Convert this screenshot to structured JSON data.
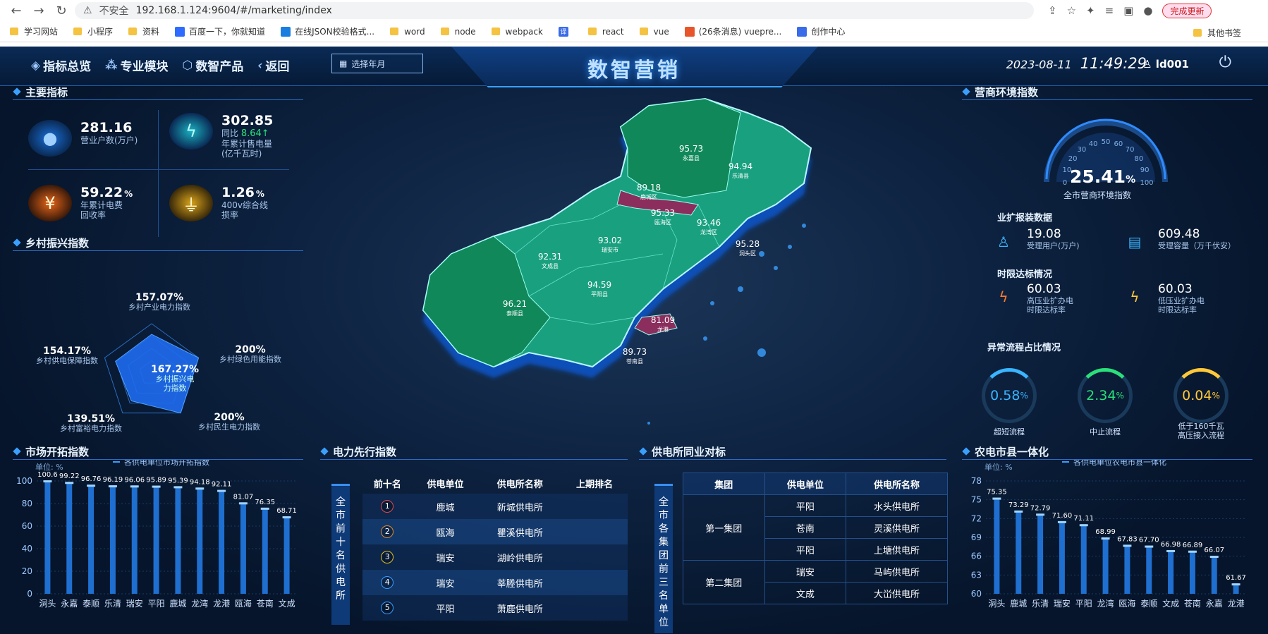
{
  "browser": {
    "insecure": "不安全",
    "url": "192.168.1.124:9604/#/marketing/index",
    "update": "完成更新",
    "bookmarks": [
      "学习网站",
      "小程序",
      "资料",
      "百度一下，你就知道",
      "在线JSON校验格式...",
      "word",
      "node",
      "webpack",
      "译",
      "react",
      "vue",
      "(26条消息) vuepre...",
      "创作中心"
    ],
    "bookmarks_right": "其他书签"
  },
  "header": {
    "title": "数智营销",
    "nav": [
      "指标总览",
      "专业模块",
      "数智产品",
      "返回"
    ],
    "month_placeholder": "选择年月",
    "date": "2023-08-11",
    "time": "11:49:29",
    "user": "ld001"
  },
  "main_index": {
    "title": "主要指标",
    "kpis": [
      {
        "value": "281.16",
        "label": "营业户数(万户)"
      },
      {
        "value": "302.85",
        "yoy_label": "同比",
        "yoy": "8.64↑",
        "label1": "年累计售电量",
        "label2": "(亿千瓦时)"
      },
      {
        "value": "59.22",
        "unit": "%",
        "label1": "年累计电费",
        "label2": "回收率"
      },
      {
        "value": "1.26",
        "unit": "%",
        "label1": "400v综合线",
        "label2": "损率"
      }
    ]
  },
  "rural": {
    "title": "乡村振兴指数",
    "center_value": "167.27%",
    "center_label1": "乡村振兴电",
    "center_label2": "力指数",
    "axes": [
      {
        "v": "157.07%",
        "l": "乡村产业电力指数"
      },
      {
        "v": "200%",
        "l": "乡村绿色用能指数"
      },
      {
        "v": "200%",
        "l": "乡村民生电力指数"
      },
      {
        "v": "139.51%",
        "l": "乡村富裕电力指数"
      },
      {
        "v": "154.17%",
        "l": "乡村供电保障指数"
      }
    ],
    "values": [
      157.07,
      200,
      200,
      139.51,
      154.17
    ]
  },
  "map": {
    "regions": [
      {
        "v": "95.73",
        "n": "永嘉县"
      },
      {
        "v": "94.94",
        "n": "乐清县"
      },
      {
        "v": "89.18",
        "n": "鹿城区"
      },
      {
        "v": "95.33",
        "n": "瓯海区"
      },
      {
        "v": "93.46",
        "n": "龙湾区"
      },
      {
        "v": "95.28",
        "n": "洞头区"
      },
      {
        "v": "93.02",
        "n": "瑞安市"
      },
      {
        "v": "92.31",
        "n": "文成县"
      },
      {
        "v": "94.59",
        "n": "平阳县"
      },
      {
        "v": "81.09",
        "n": "龙港"
      },
      {
        "v": "96.21",
        "n": "泰顺县"
      },
      {
        "v": "89.73",
        "n": "苍南县"
      }
    ]
  },
  "business": {
    "title": "营商环境指数",
    "gauge_value": "25.41",
    "gauge_unit": "%",
    "gauge_label": "全市营商环境指数",
    "gauge_ticks": [
      "0",
      "10",
      "20",
      "30",
      "40",
      "50",
      "60",
      "70",
      "80",
      "90",
      "100"
    ],
    "sec1": "业扩报装数据",
    "s1": [
      {
        "v": "19.08",
        "l": "受理用户(万户)"
      },
      {
        "v": "609.48",
        "l": "受理容量（万千伏安）"
      }
    ],
    "sec2": "时限达标情况",
    "s2": [
      {
        "v": "60.03",
        "l1": "高压业扩办电",
        "l2": "时限达标率"
      },
      {
        "v": "60.03",
        "l1": "低压业扩办电",
        "l2": "时限达标率"
      }
    ],
    "sec3": "异常流程占比情况",
    "rings": [
      {
        "v": "0.58",
        "u": "%",
        "l1": "超短流程",
        "l2": "",
        "color": "#3ab5ff"
      },
      {
        "v": "2.34",
        "u": "%",
        "l1": "中止流程",
        "l2": "",
        "color": "#2ae07a"
      },
      {
        "v": "0.04",
        "u": "%",
        "l1": "低于160千瓦",
        "l2": "高压接入流程",
        "color": "#ffc83a"
      }
    ]
  },
  "market": {
    "title": "市场开拓指数",
    "legend": "各供电单位市场开拓指数",
    "unit": "单位: %"
  },
  "power": {
    "title": "电力先行指数",
    "vert": "全市前十名供电所",
    "headers": [
      "前十名",
      "供电单位",
      "供电所名称",
      "上期排名"
    ],
    "rows": [
      {
        "r": "1",
        "u": "鹿城",
        "n": "新城供电所"
      },
      {
        "r": "2",
        "u": "瓯海",
        "n": "瞿溪供电所"
      },
      {
        "r": "3",
        "u": "瑞安",
        "n": "湖岭供电所"
      },
      {
        "r": "4",
        "u": "瑞安",
        "n": "莘塍供电所"
      },
      {
        "r": "5",
        "u": "平阳",
        "n": "萧鹿供电所"
      }
    ]
  },
  "peer": {
    "title": "供电所同业对标",
    "vert": "全市各集团前三名单位",
    "headers": [
      "集团",
      "供电单位",
      "供电所名称"
    ],
    "g1": "第一集团",
    "g2": "第二集团",
    "rows": [
      {
        "u": "平阳",
        "n": "水头供电所"
      },
      {
        "u": "苍南",
        "n": "灵溪供电所"
      },
      {
        "u": "平阳",
        "n": "上塘供电所"
      },
      {
        "u": "瑞安",
        "n": "马屿供电所"
      },
      {
        "u": "文成",
        "n": "大峃供电所"
      }
    ]
  },
  "agri": {
    "title": "农电市县一体化",
    "legend": "各供电单位农电市县一体化",
    "unit": "单位: %"
  },
  "chart_data": [
    {
      "type": "bar",
      "title": "市场开拓指数",
      "ylabel": "单位: %",
      "legend": [
        "各供电单位市场开拓指数"
      ],
      "ylim": [
        0,
        100
      ],
      "yticks": [
        0,
        20,
        40,
        60,
        80,
        100
      ],
      "categories": [
        "洞头",
        "永嘉",
        "泰顺",
        "乐清",
        "瑞安",
        "平阳",
        "鹿城",
        "龙湾",
        "龙港",
        "瓯海",
        "苍南",
        "文成"
      ],
      "values": [
        100.6,
        99.22,
        96.76,
        96.19,
        96.06,
        95.89,
        95.39,
        94.18,
        92.11,
        81.07,
        76.35,
        68.71
      ],
      "labels": [
        "100.6",
        "99.22",
        "96.76",
        "96.19",
        "96.06",
        "95.89",
        "95.39",
        "94.18",
        "92.11",
        "81.07",
        "76.35",
        "68.71"
      ]
    },
    {
      "type": "bar",
      "title": "农电市县一体化",
      "ylabel": "单位: %",
      "legend": [
        "各供电单位农电市县一体化"
      ],
      "ylim": [
        60,
        78
      ],
      "yticks": [
        60,
        63,
        66,
        69,
        72,
        75,
        78
      ],
      "categories": [
        "洞头",
        "鹿城",
        "乐清",
        "瑞安",
        "平阳",
        "龙湾",
        "瓯海",
        "泰顺",
        "文成",
        "苍南",
        "永嘉",
        "龙港"
      ],
      "values": [
        75.35,
        73.29,
        72.79,
        71.6,
        71.11,
        68.99,
        67.83,
        67.7,
        66.98,
        66.89,
        66.07,
        61.67
      ],
      "labels": [
        "75.35",
        "73.29",
        "72.79",
        "71.60",
        "71.11",
        "68.99",
        "67.83",
        "67.70",
        "66.98",
        "66.89",
        "66.07",
        "61.67"
      ]
    }
  ]
}
